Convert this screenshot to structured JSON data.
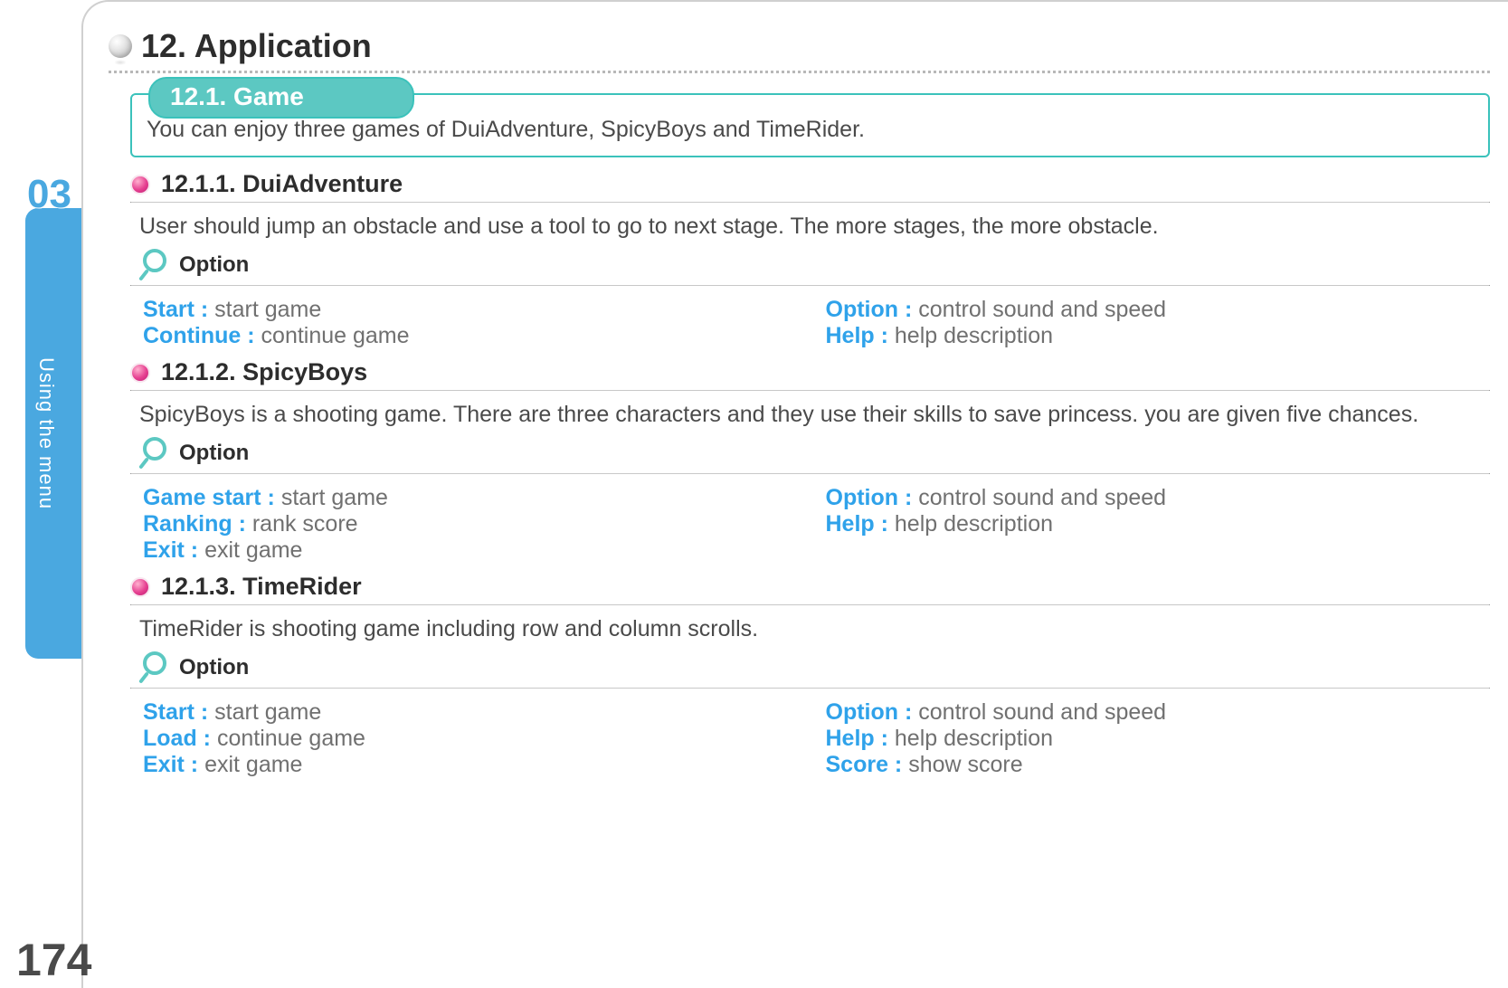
{
  "chapter": {
    "number": "03",
    "tab_label": "Using the menu"
  },
  "page": {
    "title": "12. Application",
    "number": "174"
  },
  "section": {
    "tab": "12.1. Game",
    "intro": "You can enjoy three games of DuiAdventure, SpicyBoys and TimeRider."
  },
  "subsections": [
    {
      "heading": "12.1.1. DuiAdventure",
      "desc": "User should jump an obstacle and use a tool to go to next stage. The more stages, the more obstacle.",
      "option_title": "Option",
      "left": [
        {
          "key": "Start  :",
          "val": " start game"
        },
        {
          "key": "Continue  :",
          "val": " continue game"
        }
      ],
      "right": [
        {
          "key": "Option :",
          "val": " control sound and speed"
        },
        {
          "key": "Help :",
          "val": " help description"
        }
      ]
    },
    {
      "heading": "12.1.2. SpicyBoys",
      "desc": "SpicyBoys is a shooting game. There are three characters and they use their skills to save princess. you are given five chances.",
      "option_title": "Option",
      "left": [
        {
          "key": "Game start  :",
          "val": " start game"
        },
        {
          "key": "Ranking  :",
          "val": "  rank score"
        },
        {
          "key": "Exit  :",
          "val": "  exit game"
        }
      ],
      "right": [
        {
          "key": "Option :",
          "val": " control sound and speed"
        },
        {
          "key": "Help :",
          "val": "  help description"
        }
      ]
    },
    {
      "heading": "12.1.3. TimeRider",
      "desc": "TimeRider is shooting game including row and column scrolls.",
      "option_title": "Option",
      "left": [
        {
          "key": "Start  :",
          "val": " start game"
        },
        {
          "key": "Load  :",
          "val": "  continue game"
        },
        {
          "key": "Exit  :",
          "val": "  exit game"
        }
      ],
      "right": [
        {
          "key": "Option :",
          "val": "  control sound and speed"
        },
        {
          "key": "Help :",
          "val": "  help description"
        },
        {
          "key": "Score :",
          "val": "  show score"
        }
      ]
    }
  ]
}
